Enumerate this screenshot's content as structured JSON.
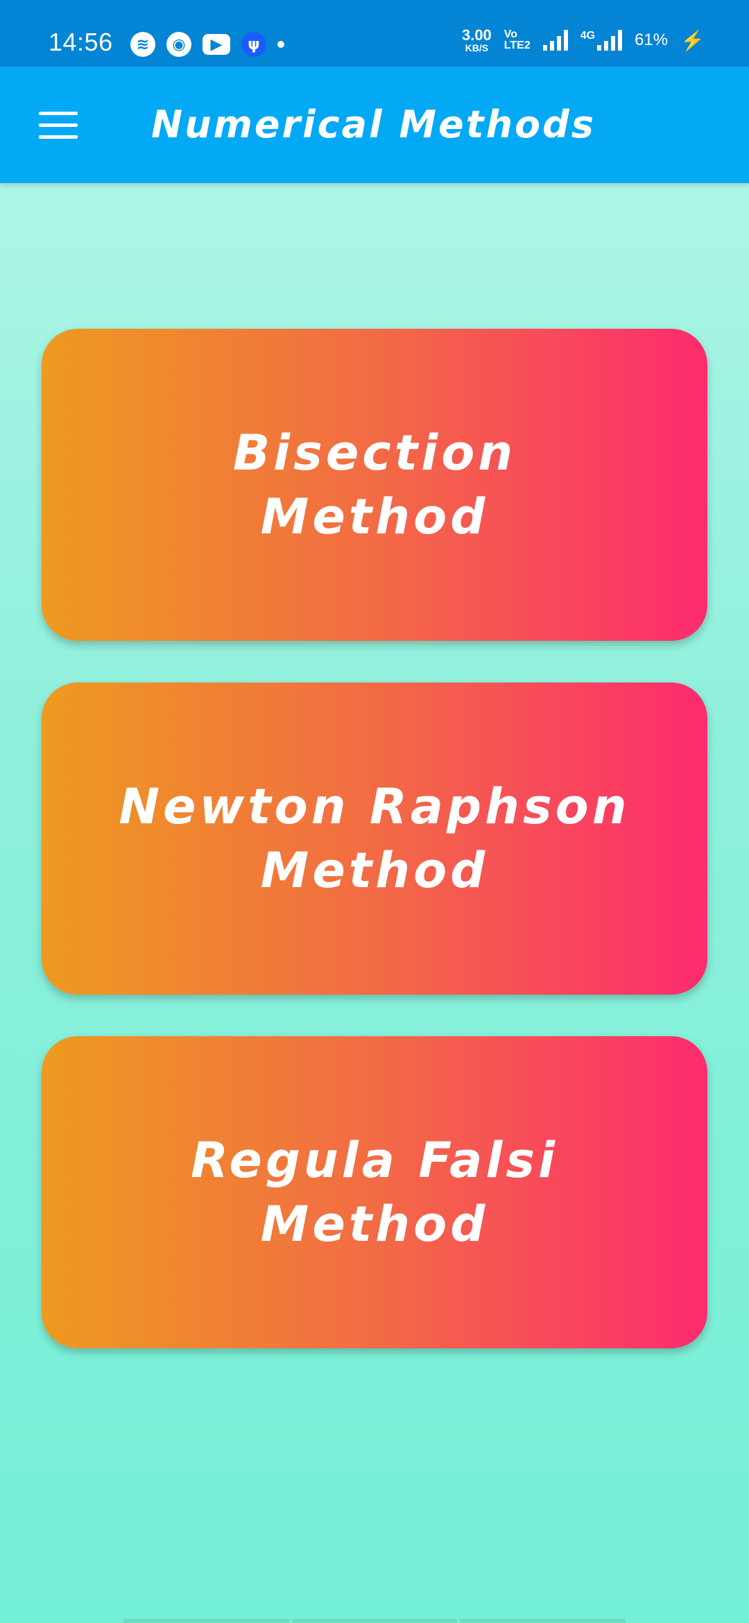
{
  "status_bar": {
    "time": "14:56",
    "net_speed_value": "3.00",
    "net_speed_unit": "KB/S",
    "volte_top": "Vo",
    "volte_bottom": "LTE2",
    "network_type": "4G",
    "battery": "61%",
    "icons": [
      "spotify-icon",
      "chrome-icon",
      "youtube-icon",
      "usb-icon",
      "dot-icon",
      "signal-icon",
      "signal-4g-icon",
      "charging-icon"
    ]
  },
  "app_bar": {
    "title": "Numerical Methods",
    "background": "#03a9f4"
  },
  "methods": [
    {
      "label": "Bisection Method"
    },
    {
      "label": "Newton Raphson Method"
    },
    {
      "label": "Regula Falsi Method"
    }
  ],
  "colors": {
    "status_bar": "#0384d4",
    "card_gradient_start": "#ee9a20",
    "card_gradient_end": "#fe2b6e",
    "background_top": "#b6f7ea",
    "background_bottom": "#74f0d6"
  }
}
